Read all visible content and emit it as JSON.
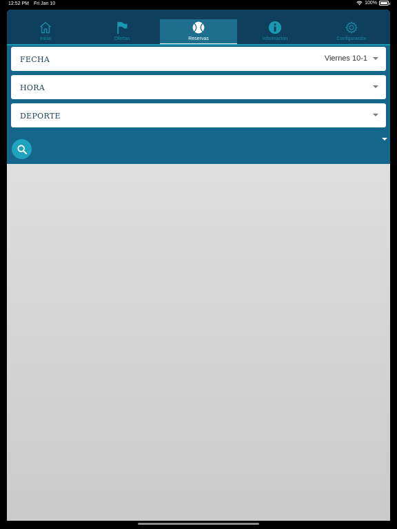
{
  "status_bar": {
    "time": "12:52 PM",
    "date": "Fri Jan 10",
    "battery": "100%",
    "battery_level": 1.0,
    "wifi_icon": "wifi-icon"
  },
  "tabs": [
    {
      "label": "Inicio",
      "icon": "home-icon"
    },
    {
      "label": "Ofertas",
      "icon": "flag-icon"
    },
    {
      "label": "Reservas",
      "icon": "tennis-ball-icon",
      "active": true
    },
    {
      "label": "Información",
      "icon": "info-icon"
    },
    {
      "label": "Configuración",
      "icon": "gear-icon"
    }
  ],
  "filters": {
    "fecha": {
      "label": "FECHA",
      "value": "Viernes 10-1"
    },
    "hora": {
      "label": "HORA",
      "value": ""
    },
    "deporte": {
      "label": "DEPORTE",
      "value": ""
    }
  },
  "colors": {
    "tabbar_bg": "#0e3f5c",
    "active_tab_bg": "#1e6e8d",
    "accent": "#1fa3bd",
    "panel_bg": "#14678a",
    "label_text": "#1b3f55"
  },
  "search_icon": "search-icon"
}
